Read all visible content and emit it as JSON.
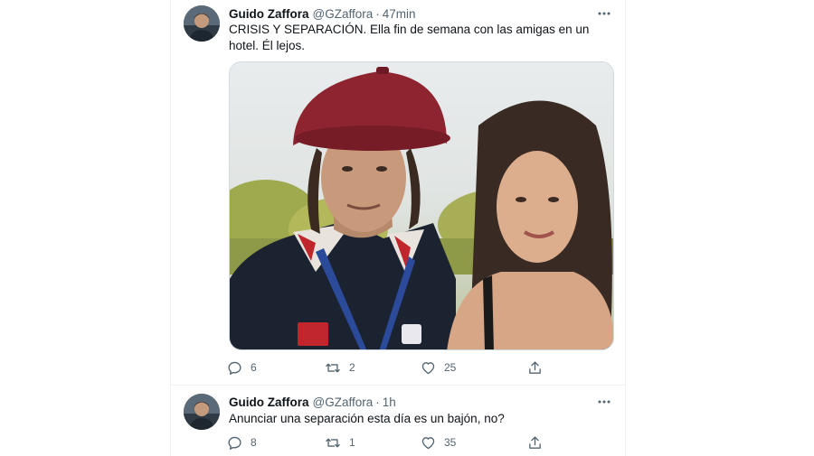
{
  "tweets": [
    {
      "author": "Guido Zaffora",
      "handle": "@GZaffora",
      "separator": "·",
      "time": "47min",
      "text": "CRISIS Y SEPARACIÓN. Ella fin de semana con las amigas en un hotel. Él lejos.",
      "replies": "6",
      "retweets": "2",
      "likes": "25"
    },
    {
      "author": "Guido Zaffora",
      "handle": "@GZaffora",
      "separator": "·",
      "time": "1h",
      "text": "Anunciar una separación esta día es un bajón, no?",
      "replies": "8",
      "retweets": "1",
      "likes": "35"
    }
  ],
  "icons": {
    "more": "more-horizontal-icon",
    "reply": "reply-icon",
    "retweet": "retweet-icon",
    "like": "heart-icon",
    "share": "share-icon"
  },
  "colors": {
    "text": "#0f1419",
    "secondary": "#536471",
    "border": "#eff3f4"
  }
}
